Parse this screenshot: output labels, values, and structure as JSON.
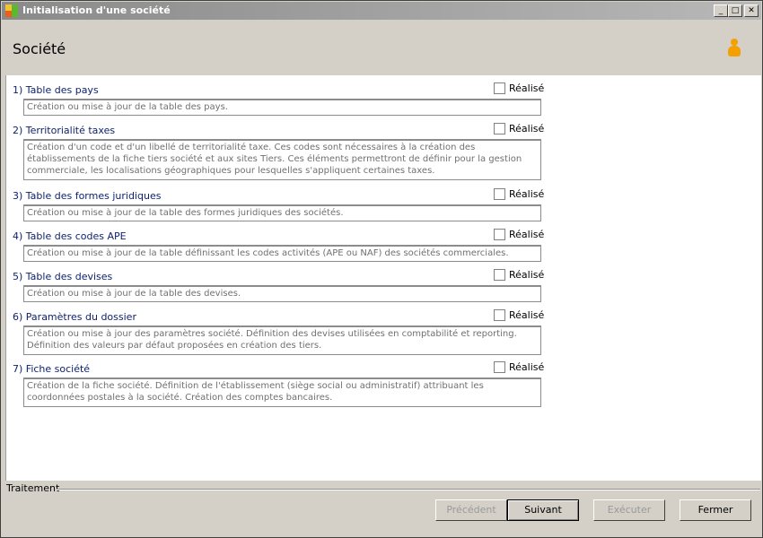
{
  "window": {
    "title": "Initialisation d'une société",
    "controls": {
      "minimize": "_",
      "maximize": "□",
      "close": "✕"
    }
  },
  "header": {
    "title": "Société",
    "icon": "user-icon"
  },
  "steps": [
    {
      "label": "1) Table des pays",
      "done_label": "Réalisé",
      "description": "Création ou mise à jour de la table des pays."
    },
    {
      "label": "2) Territorialité taxes",
      "done_label": "Réalisé",
      "description": "Création d'un code et d'un libellé de territorialité taxe. Ces codes sont nécessaires à la création des établissements de la fiche tiers société et aux sites Tiers. Ces éléments permettront de définir pour la gestion commerciale, les localisations géographiques pour lesquelles s'appliquent certaines taxes."
    },
    {
      "label": "3) Table des formes juridiques",
      "done_label": "Réalisé",
      "description": "Création ou mise à jour de la table des formes juridiques des sociétés."
    },
    {
      "label": "4) Table des codes APE",
      "done_label": "Réalisé",
      "description": "Création ou mise à jour de la table définissant les codes activités (APE ou NAF) des sociétés commerciales."
    },
    {
      "label": "5) Table des devises",
      "done_label": "Réalisé",
      "description": "Création ou mise à jour de la table des devises."
    },
    {
      "label": "6) Paramètres du dossier",
      "done_label": "Réalisé",
      "description": "Création ou mise à jour des paramètres société. Définition des devises utilisées en comptabilité et reporting. Définition des valeurs par défaut proposées en création des tiers."
    },
    {
      "label": "7) Fiche société",
      "done_label": "Réalisé",
      "description": "Création de la fiche société. Définition de l'établissement (siège social ou administratif) attribuant les coordonnées postales à la société. Création des comptes bancaires."
    }
  ],
  "footer": {
    "section_label": "Traitement",
    "buttons": {
      "previous": "Précédent",
      "next": "Suivant",
      "execute": "Exécuter",
      "close": "Fermer"
    }
  }
}
